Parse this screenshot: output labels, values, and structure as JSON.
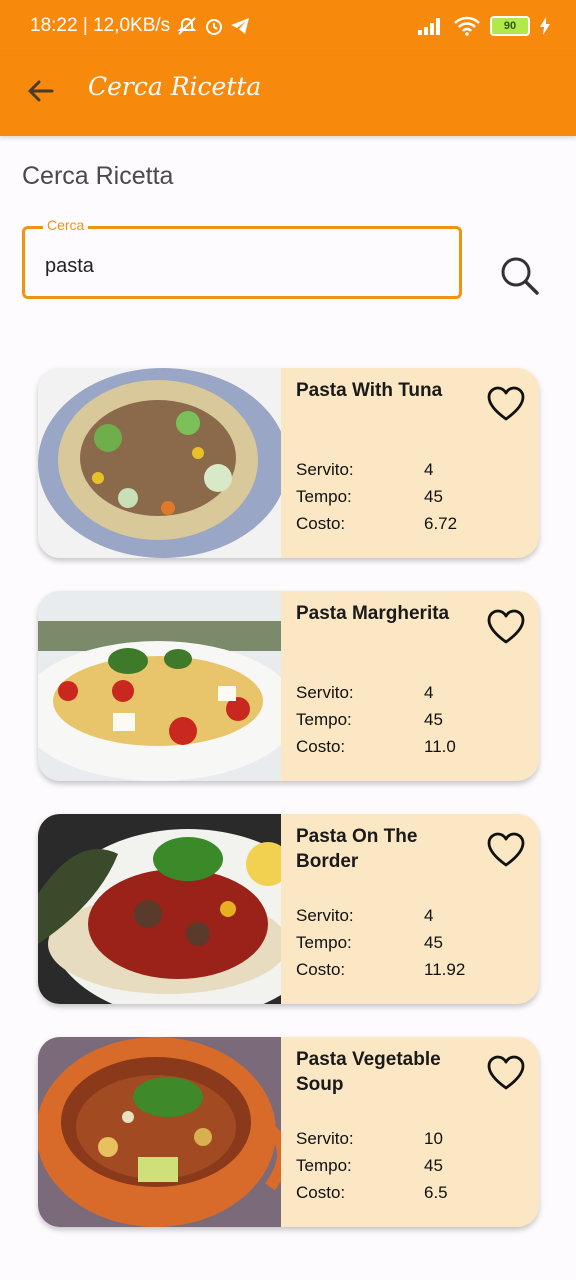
{
  "status_bar": {
    "time_info": "18:22 | 12,0KB/s",
    "battery": "90"
  },
  "app_bar": {
    "title": "Cerca Ricetta",
    "back_icon": "arrow-back-icon"
  },
  "page": {
    "title": "Cerca Ricetta"
  },
  "search": {
    "label": "Cerca",
    "value": "pasta",
    "icon": "search-icon"
  },
  "labels": {
    "servings": "Servito:",
    "time": "Tempo:",
    "cost": "Costo:"
  },
  "recipes": [
    {
      "title": "Pasta With Tuna",
      "servings": "4",
      "time": "45",
      "cost": "6.72"
    },
    {
      "title": "Pasta Margherita",
      "servings": "4",
      "time": "45",
      "cost": "11.0"
    },
    {
      "title": "Pasta On The Border",
      "servings": "4",
      "time": "45",
      "cost": "11.92"
    },
    {
      "title": "Pasta Vegetable Soup",
      "servings": "10",
      "time": "45",
      "cost": "6.5"
    }
  ],
  "colors": {
    "primary": "#f7890c",
    "card_bg": "#fbe7c3",
    "search_border": "#ef9412"
  }
}
